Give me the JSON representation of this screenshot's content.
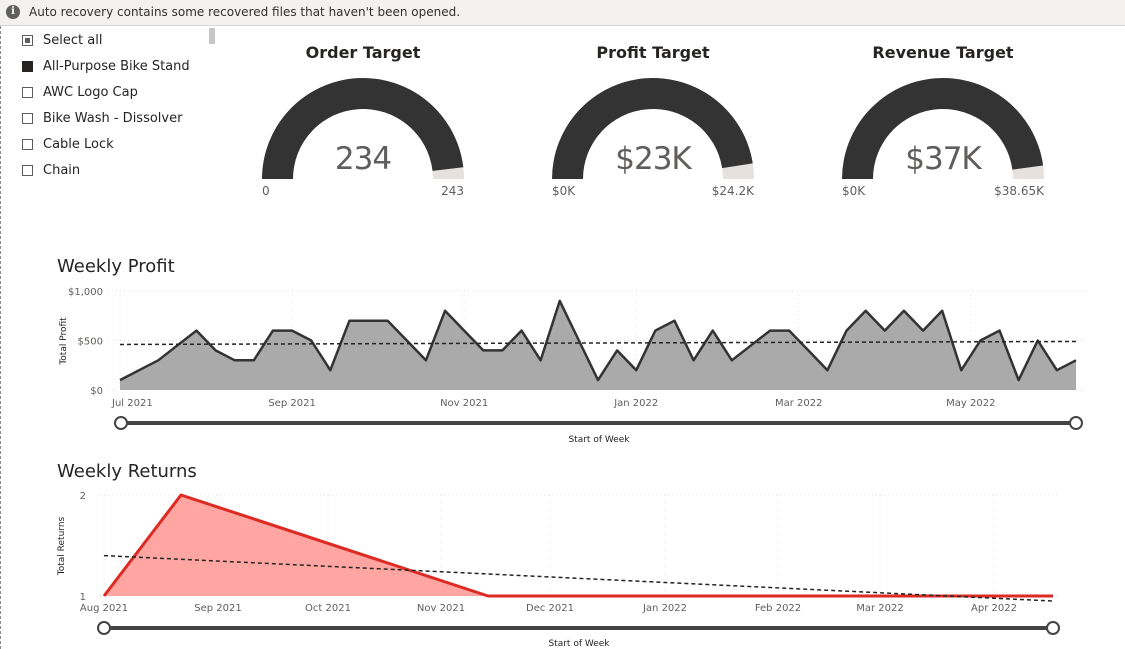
{
  "notification": {
    "icon": "info-icon",
    "message": "Auto recovery contains some recovered files that haven't been opened."
  },
  "slicer": {
    "items": [
      {
        "label": "Select all",
        "state": "partial"
      },
      {
        "label": "All-Purpose Bike Stand",
        "state": "checked"
      },
      {
        "label": "AWC Logo Cap",
        "state": "unchecked"
      },
      {
        "label": "Bike Wash - Dissolver",
        "state": "unchecked"
      },
      {
        "label": "Cable Lock",
        "state": "unchecked"
      },
      {
        "label": "Chain",
        "state": "unchecked"
      }
    ]
  },
  "gauges": [
    {
      "title": "Order Target",
      "value_label": "234",
      "min_label": "0",
      "max_label": "243",
      "value": 234,
      "max": 243
    },
    {
      "title": "Profit Target",
      "value_label": "$23K",
      "min_label": "$0K",
      "max_label": "$24.2K",
      "value": 23,
      "max": 24.2
    },
    {
      "title": "Revenue Target",
      "value_label": "$37K",
      "min_label": "$0K",
      "max_label": "$38.65K",
      "value": 37,
      "max": 38.65
    }
  ],
  "colors": {
    "gauge_fill": "#333333",
    "gauge_track": "#e6e1dc",
    "profit_area": "#aaaaaa",
    "profit_line": "#333333",
    "returns_area": "#ffa6a3",
    "returns_line": "#dd2a22",
    "slider": "#444444"
  },
  "chart_data": [
    {
      "type": "area",
      "title": "Weekly Profit",
      "ylabel": "Total Profit",
      "xlabel": "Start of Week",
      "ylim": [
        0,
        1000
      ],
      "yticks": [
        0,
        500,
        1000
      ],
      "ytick_labels": [
        "$0",
        "$500",
        "$1,000"
      ],
      "xtick_labels": [
        "Jul 2021",
        "Sep 2021",
        "Nov 2021",
        "Jan 2022",
        "Mar 2022",
        "May 2022"
      ],
      "xtick_weeks": [
        0,
        9,
        18,
        27,
        35.5,
        44.5
      ],
      "grid": true,
      "trendline": {
        "style": "dashed",
        "start": 460,
        "end": 490
      },
      "series": [
        {
          "values": [
            100,
            200,
            300,
            450,
            600,
            400,
            300,
            300,
            600,
            600,
            500,
            200,
            700,
            700,
            700,
            500,
            300,
            800,
            600,
            400,
            400,
            600,
            300,
            900,
            500,
            100,
            400,
            200,
            600,
            700,
            300,
            600,
            300,
            450,
            600,
            600,
            400,
            200,
            600,
            800,
            600,
            800,
            600,
            800,
            200,
            500,
            600,
            100,
            500,
            200,
            300
          ]
        }
      ]
    },
    {
      "type": "area",
      "title": "Weekly Returns",
      "ylabel": "Total Returns",
      "xlabel": "Start of Week",
      "ylim": [
        1,
        2
      ],
      "yticks": [
        1,
        2
      ],
      "ytick_labels": [
        "1",
        "2"
      ],
      "xtick_labels": [
        "Aug 2021",
        "Sep 2021",
        "Oct 2021",
        "Nov 2021",
        "Dec 2021",
        "Jan 2022",
        "Feb 2022",
        "Mar 2022",
        "Apr 2022"
      ],
      "grid": true,
      "trendline": {
        "style": "dashed",
        "start": 1.4,
        "end": 0.95
      },
      "series": [
        {
          "x": [
            "Aug 2021",
            "Aug 2021 (wk 4)",
            "Nov 2021 (wk 4)",
            "Apr 2022 (end)"
          ],
          "values": [
            1,
            2,
            1,
            1
          ]
        }
      ]
    }
  ]
}
